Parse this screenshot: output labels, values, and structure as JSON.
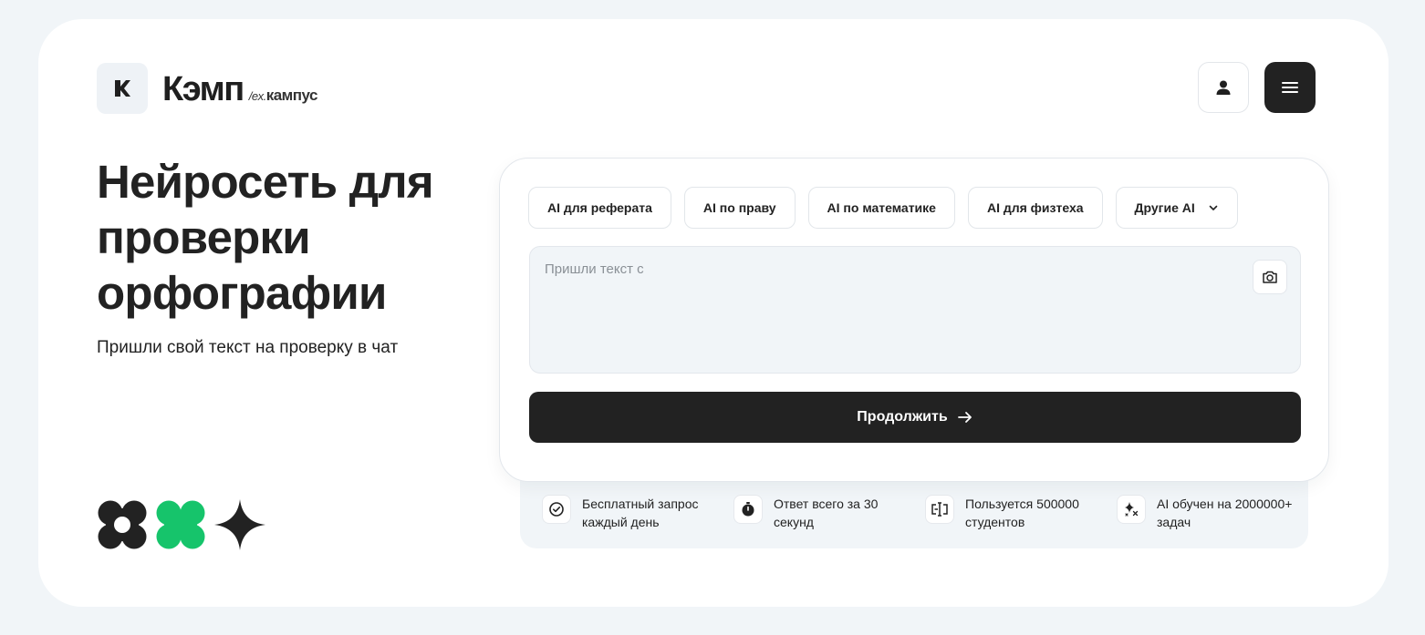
{
  "header": {
    "brand_name": "Кэмп",
    "brand_prefix": "/ex.",
    "brand_sub": "кампус",
    "logo_icon": "k-logo-icon",
    "user_icon": "user-icon",
    "menu_icon": "hamburger-menu-icon"
  },
  "hero": {
    "title": "Нейросеть для проверки орфографии",
    "subtitle": "Пришли свой текст на проверку в чат"
  },
  "decor": {
    "shapes": [
      "flower-shape",
      "clover-shape",
      "sparkle-shape"
    ],
    "colors": {
      "dark": "#222222",
      "green": "#16c46b"
    }
  },
  "panel": {
    "chips": [
      {
        "label": "AI для реферата"
      },
      {
        "label": "AI по праву"
      },
      {
        "label": "AI по математике"
      },
      {
        "label": "AI для физтеха"
      },
      {
        "label": "Другие AI"
      }
    ],
    "input": {
      "value": "",
      "placeholder": "Пришли текст с"
    },
    "camera_icon": "camera-icon",
    "continue_label": "Продолжить"
  },
  "features": [
    {
      "icon": "check-circle-icon",
      "text": "Бесплатный запрос каждый день"
    },
    {
      "icon": "stopwatch-icon",
      "text": "Ответ всего за 30 секунд"
    },
    {
      "icon": "text-cursor-icon",
      "text": "Пользуется 500000 студентов"
    },
    {
      "icon": "sparkles-icon",
      "text": "AI обучен на 2000000+ задач"
    }
  ],
  "colors": {
    "background": "#f1f5f8",
    "card": "#ffffff",
    "dark": "#222222",
    "accent_green": "#16c46b"
  }
}
